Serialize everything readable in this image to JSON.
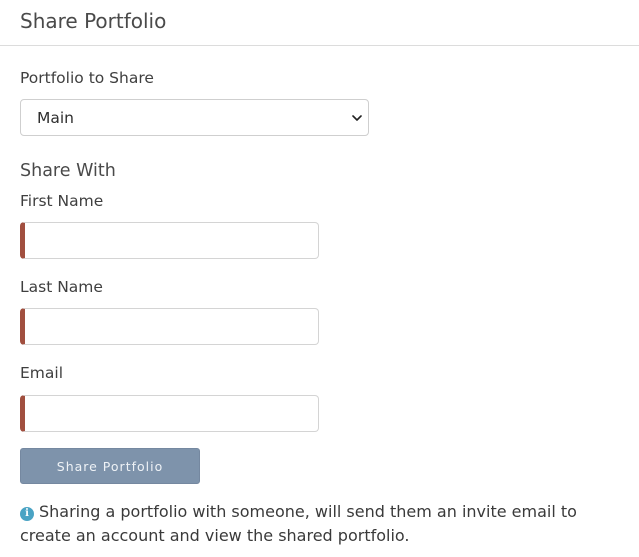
{
  "header": {
    "title": "Share Portfolio"
  },
  "portfolio": {
    "label": "Portfolio to Share",
    "selected": "Main"
  },
  "share_with": {
    "title": "Share With",
    "first_name_label": "First Name",
    "first_name_value": "",
    "last_name_label": "Last Name",
    "last_name_value": "",
    "email_label": "Email",
    "email_value": ""
  },
  "button": {
    "label": "Share Portfolio"
  },
  "info": {
    "icon": "info-icon",
    "text": "Sharing a portfolio with someone, will send them an invite email to create an account and view the shared portfolio."
  },
  "colors": {
    "required_bar": "#a14f3f",
    "button_bg": "#7e93ab",
    "info_icon": "#4aa3c4"
  }
}
